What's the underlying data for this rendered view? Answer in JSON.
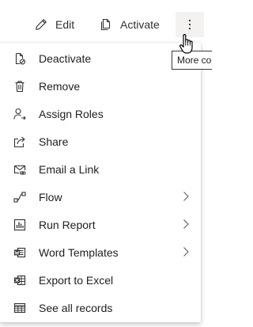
{
  "command_bar": {
    "edit_label": "Edit",
    "activate_label": "Activate",
    "more_tooltip": "More commands"
  },
  "menu": {
    "items": [
      {
        "label": "Deactivate",
        "icon": "deactivate-icon",
        "has_submenu": false
      },
      {
        "label": "Remove",
        "icon": "trash-icon",
        "has_submenu": false
      },
      {
        "label": "Assign Roles",
        "icon": "person-arrow-icon",
        "has_submenu": false
      },
      {
        "label": "Share",
        "icon": "share-icon",
        "has_submenu": false
      },
      {
        "label": "Email a Link",
        "icon": "email-link-icon",
        "has_submenu": false
      },
      {
        "label": "Flow",
        "icon": "flow-icon",
        "has_submenu": true
      },
      {
        "label": "Run Report",
        "icon": "report-icon",
        "has_submenu": true
      },
      {
        "label": "Word Templates",
        "icon": "word-icon",
        "has_submenu": true
      },
      {
        "label": "Export to Excel",
        "icon": "excel-icon",
        "has_submenu": false
      },
      {
        "label": "See all records",
        "icon": "table-icon",
        "has_submenu": false
      }
    ]
  },
  "colors": {
    "text": "#201f1e",
    "icon": "#323130",
    "hover_bg": "#f3f2f1",
    "tooltip_border": "#3b3a39"
  }
}
